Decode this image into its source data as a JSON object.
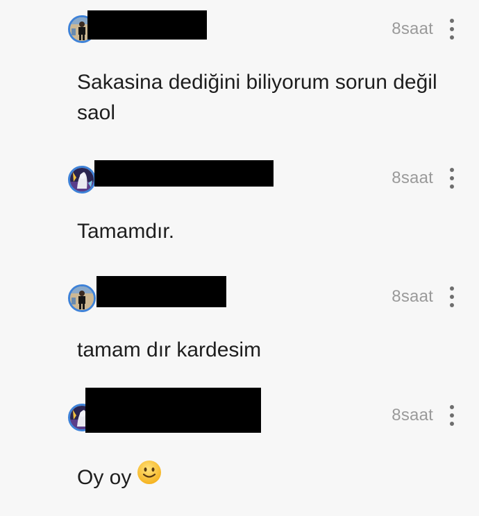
{
  "comments": [
    {
      "time": "8saat",
      "text": "Sakasina dediğini biliyorum sorun değil saol",
      "avatar_icon": "user-avatar-photo"
    },
    {
      "time": "8saat",
      "text": "Tamamdır.",
      "avatar_icon": "user-avatar-illustration"
    },
    {
      "time": "8saat",
      "text": "tamam dır kardesim",
      "avatar_icon": "user-avatar-photo"
    },
    {
      "time": "8saat",
      "text": "Oy oy",
      "emoji": "slightly-smiling-face"
    }
  ],
  "colors": {
    "background": "#f7f7f7",
    "avatar_ring": "#3e82d8",
    "time_text": "#9a9a9a",
    "body_text": "#1e1e1e",
    "redaction": "#000000"
  }
}
